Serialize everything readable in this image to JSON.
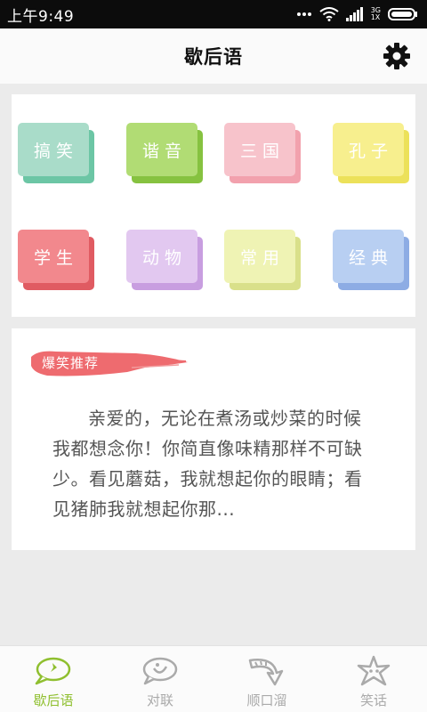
{
  "status_bar": {
    "time": "上午9:49",
    "network": "3G",
    "network_sub": "1X"
  },
  "header": {
    "title": "歇后语",
    "settings_icon": "gear-icon"
  },
  "categories": [
    {
      "label": "搞笑",
      "color": "#a9dcc9",
      "shadow": "#6cc6a5"
    },
    {
      "label": "谐音",
      "color": "#b1dc74",
      "shadow": "#86c240"
    },
    {
      "label": "三国",
      "color": "#f7c3cb",
      "shadow": "#f2a1ad"
    },
    {
      "label": "孔子",
      "color": "#f7ef8e",
      "shadow": "#ece15a"
    },
    {
      "label": "学生",
      "color": "#f2888d",
      "shadow": "#e05b62"
    },
    {
      "label": "动物",
      "color": "#e2c8f0",
      "shadow": "#c89ee0"
    },
    {
      "label": "常用",
      "color": "#eff3b4",
      "shadow": "#d9e08a"
    },
    {
      "label": "经典",
      "color": "#b8cff2",
      "shadow": "#8dace4"
    }
  ],
  "recommend": {
    "badge": "爆笑推荐",
    "badge_color": "#ee6b6f",
    "text": "亲爱的，无论在煮汤或炒菜的时候我都想念你！你简直像味精那样不可缺少。看见蘑菇，我就想起你的眼睛；看见猪肺我就想起你那..."
  },
  "bottom_nav": [
    {
      "label": "歇后语",
      "icon": "speech-bubble-icon",
      "active": true
    },
    {
      "label": "对联",
      "icon": "heart-bubble-icon",
      "active": false
    },
    {
      "label": "顺口溜",
      "icon": "arrow-icon",
      "active": false
    },
    {
      "label": "笑话",
      "icon": "star-icon",
      "active": false
    }
  ],
  "colors": {
    "accent": "#8fbf2f",
    "inactive": "#aaaaaa"
  }
}
